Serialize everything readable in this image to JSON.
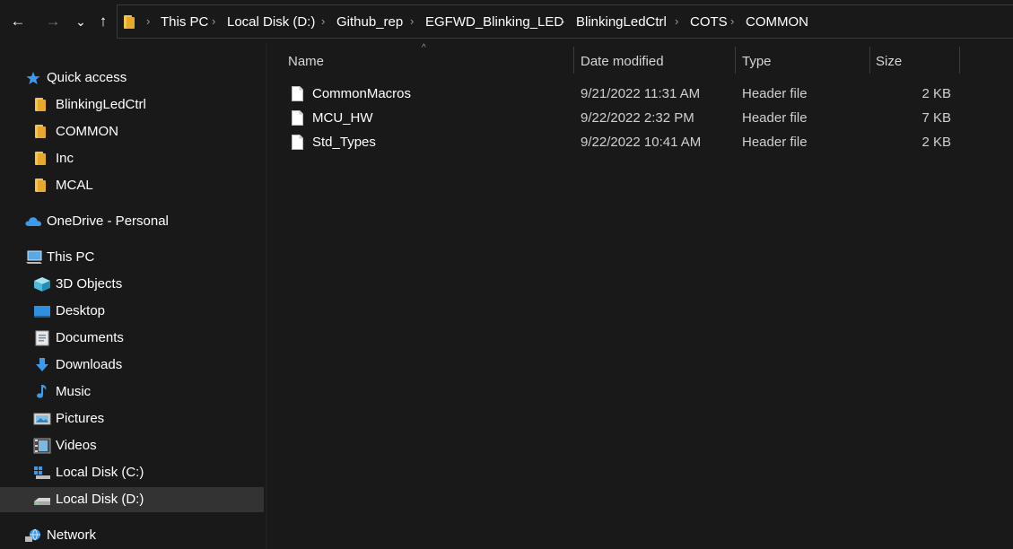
{
  "nav": {
    "back_icon": "←",
    "forward_icon": "→",
    "recent_icon": "⌄",
    "up_icon": "↑"
  },
  "breadcrumbs": [
    "This PC",
    "Local Disk (D:)",
    "Github_rep",
    "EGFWD_Blinking_LED",
    "BlinkingLedCtrl",
    "COTS",
    "COMMON"
  ],
  "breadcrumb_separator": "›",
  "sidebar": {
    "items": [
      {
        "label": "Quick access",
        "icon": "star-icon"
      },
      {
        "label": "BlinkingLedCtrl",
        "icon": "folder-icon"
      },
      {
        "label": "COMMON",
        "icon": "folder-icon"
      },
      {
        "label": "Inc",
        "icon": "folder-icon"
      },
      {
        "label": "MCAL",
        "icon": "folder-icon"
      },
      {
        "label": "OneDrive - Personal",
        "icon": "cloud-icon"
      },
      {
        "label": "This PC",
        "icon": "computer-icon"
      },
      {
        "label": "3D Objects",
        "icon": "cube-icon"
      },
      {
        "label": "Desktop",
        "icon": "desktop-icon"
      },
      {
        "label": "Documents",
        "icon": "documents-icon"
      },
      {
        "label": "Downloads",
        "icon": "download-icon"
      },
      {
        "label": "Music",
        "icon": "music-icon"
      },
      {
        "label": "Pictures",
        "icon": "pictures-icon"
      },
      {
        "label": "Videos",
        "icon": "videos-icon"
      },
      {
        "label": "Local Disk (C:)",
        "icon": "windows-drive-icon"
      },
      {
        "label": "Local Disk (D:)",
        "icon": "drive-icon",
        "selected": true
      },
      {
        "label": "Network",
        "icon": "network-icon"
      }
    ]
  },
  "columns": {
    "name": "Name",
    "date": "Date modified",
    "type": "Type",
    "size": "Size",
    "sort_caret": "^"
  },
  "files": [
    {
      "name": "CommonMacros",
      "date": "9/21/2022 11:31 AM",
      "type": "Header file",
      "size": "2 KB"
    },
    {
      "name": "MCU_HW",
      "date": "9/22/2022 2:32 PM",
      "type": "Header file",
      "size": "7 KB"
    },
    {
      "name": "Std_Types",
      "date": "9/22/2022 10:41 AM",
      "type": "Header file",
      "size": "2 KB"
    }
  ],
  "colors": {
    "background": "#191919",
    "selected": "#333333",
    "accent_blue": "#3b9bea",
    "folder_yellow": "#f3c54f"
  }
}
